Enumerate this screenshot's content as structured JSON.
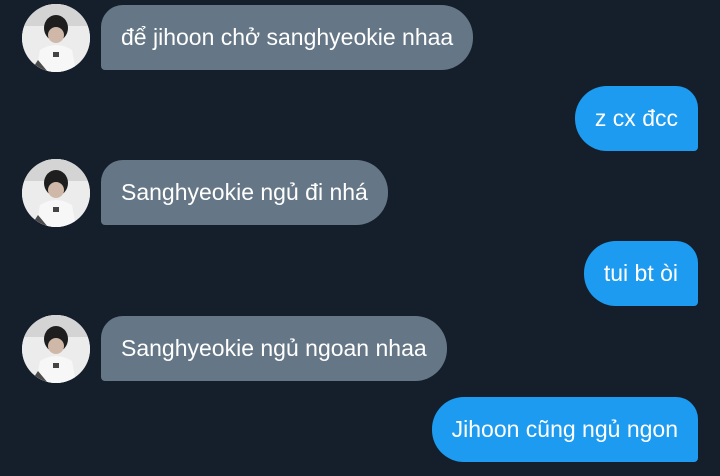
{
  "colors": {
    "background": "#151f2b",
    "incoming_bubble": "#657786",
    "outgoing_bubble": "#1d9bf0",
    "text": "#ffffff"
  },
  "messages": [
    {
      "direction": "incoming",
      "text": "để jihoon chở sanghyeokie nhaa"
    },
    {
      "direction": "outgoing",
      "text": "z cx đcc"
    },
    {
      "direction": "incoming",
      "text": "Sanghyeokie ngủ đi nhá"
    },
    {
      "direction": "outgoing",
      "text": "tui bt òi"
    },
    {
      "direction": "incoming",
      "text": "Sanghyeokie ngủ ngoan nhaa"
    },
    {
      "direction": "outgoing",
      "text": "Jihoon cũng ngủ ngon"
    }
  ]
}
